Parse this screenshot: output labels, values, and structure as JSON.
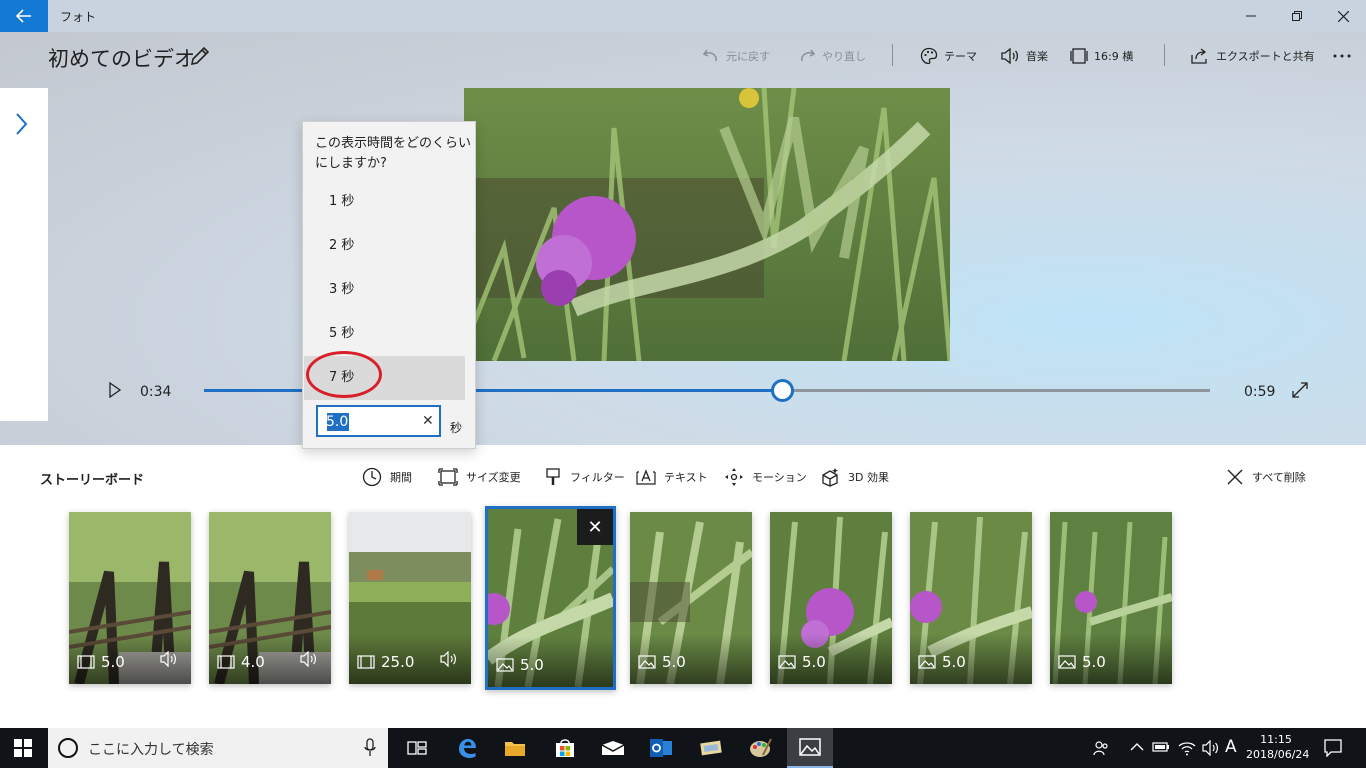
{
  "window": {
    "title": "フォト"
  },
  "project": {
    "title": "初めてのビデオ"
  },
  "toolbar": {
    "undo": "元に戻す",
    "redo": "やり直し",
    "theme": "テーマ",
    "music": "音楽",
    "aspect": "16:9 横",
    "export": "エクスポートと共有"
  },
  "player": {
    "current_time": "0:34",
    "total_time": "0:59",
    "progress": 0.575
  },
  "duration_popup": {
    "question": "この表示時間をどのくらいにしますか?",
    "options": [
      "1 秒",
      "2 秒",
      "3 秒",
      "5 秒",
      "7 秒"
    ],
    "selected": "7 秒",
    "input_value": "5.0",
    "unit": "秒"
  },
  "storyboard": {
    "title": "ストーリーボード",
    "tools": {
      "duration": "期間",
      "resize": "サイズ変更",
      "filter": "フィルター",
      "text": "テキスト",
      "motion": "モーション",
      "effects3d": "3D 効果",
      "delete_all": "すべて削除"
    },
    "clips": [
      {
        "kind": "video",
        "duration": "5.0",
        "audio": true,
        "icon": "video-clip-icon"
      },
      {
        "kind": "video",
        "duration": "4.0",
        "audio": true,
        "icon": "video-clip-icon"
      },
      {
        "kind": "video",
        "duration": "25.0",
        "audio": true,
        "icon": "video-clip-icon"
      },
      {
        "kind": "photo",
        "duration": "5.0",
        "audio": false,
        "icon": "photo-clip-icon",
        "selected": true
      },
      {
        "kind": "photo",
        "duration": "5.0",
        "audio": false,
        "icon": "photo-clip-icon"
      },
      {
        "kind": "photo",
        "duration": "5.0",
        "audio": false,
        "icon": "photo-clip-icon"
      },
      {
        "kind": "photo",
        "duration": "5.0",
        "audio": false,
        "icon": "photo-clip-icon"
      },
      {
        "kind": "photo",
        "duration": "5.0",
        "audio": false,
        "icon": "photo-clip-icon"
      }
    ]
  },
  "taskbar": {
    "search_placeholder": "ここに入力して検索",
    "ime": "A",
    "time": "11:15",
    "date": "2018/06/24"
  },
  "colors": {
    "accent": "#1f6fc5",
    "annotation": "#d9202a",
    "taskbar": "#101418"
  }
}
